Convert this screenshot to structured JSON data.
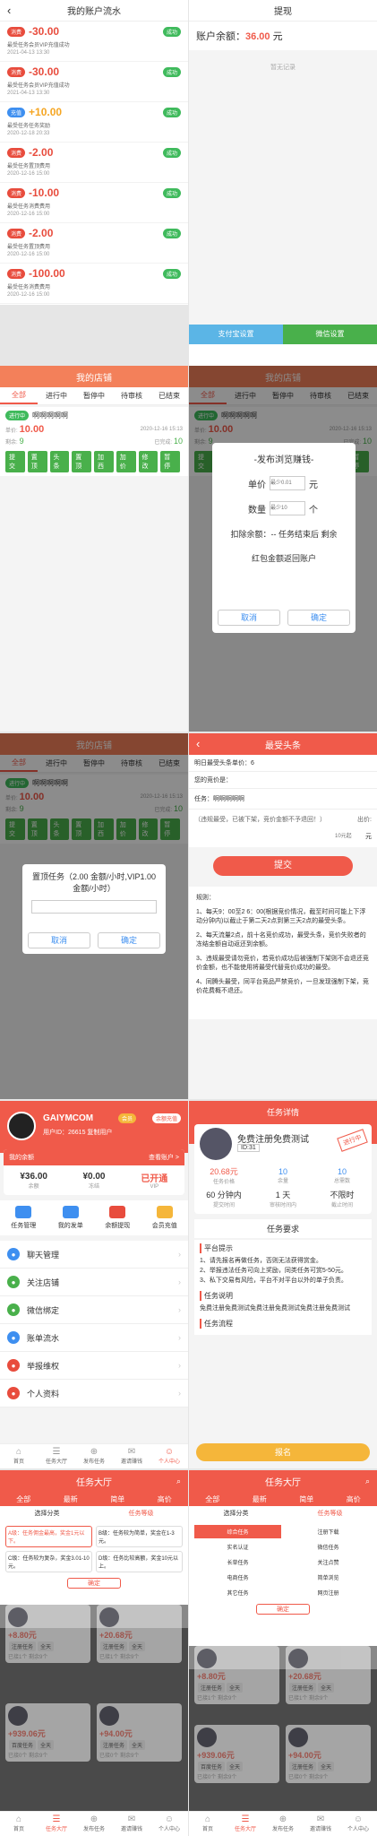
{
  "p1": {
    "title": "我的账户流水",
    "records": [
      {
        "badge": "消费",
        "amount": "-30.00",
        "desc": "最受任务会员VIP充值成功",
        "time": "2021-04-13 13:30",
        "type": "red"
      },
      {
        "badge": "消费",
        "amount": "-30.00",
        "desc": "最受任务会员VIP充值成功",
        "time": "2021-04-13 13:30",
        "type": "red"
      },
      {
        "badge": "充值",
        "amount": "+10.00",
        "desc": "最受任务任务奖励",
        "time": "2020-12-18 20:33",
        "type": "blue"
      },
      {
        "badge": "消费",
        "amount": "-2.00",
        "desc": "最受任务置顶费用",
        "time": "2020-12-16 15:00",
        "type": "red"
      },
      {
        "badge": "消费",
        "amount": "-10.00",
        "desc": "最受任务消费费用",
        "time": "2020-12-16 15:00",
        "type": "red"
      },
      {
        "badge": "消费",
        "amount": "-2.00",
        "desc": "最受任务置顶费用",
        "time": "2020-12-16 15:00",
        "type": "red"
      },
      {
        "badge": "消费",
        "amount": "-100.00",
        "desc": "最受任务消费费用",
        "time": "2020-12-16 15:00",
        "type": "red"
      }
    ],
    "status": "成功"
  },
  "p2": {
    "title": "提现",
    "balance_label": "账户余额：",
    "balance": "36.00",
    "unit": "元",
    "empty": "暂无记录",
    "btn_left": "支付宝设置",
    "btn_right": "微信设置"
  },
  "shop": {
    "title": "我的店铺",
    "tabs": [
      "全部",
      "进行中",
      "暂停中",
      "待审核",
      "已结束"
    ],
    "status": "进行中",
    "name": "啊啊啊啊啊",
    "price_label": "单价:",
    "price": "10.00",
    "time": "2020-12-16 15:13",
    "remain_label": "剩余:",
    "remain": "9",
    "done_label": "已完成:",
    "done": "10",
    "actions": [
      "提交",
      "置顶",
      "头条",
      "置顶",
      "加西",
      "加价",
      "修改",
      "暂停"
    ]
  },
  "modal1": {
    "title": "-发布浏览赚钱-",
    "price_label": "单价",
    "price_ph": "最少0.01",
    "price_unit": "元",
    "qty_label": "数量",
    "qty_ph": "最少10",
    "qty_unit": "个",
    "deduct": "扣除余额：-- 任务结束后 剩余",
    "refund": "红包金额返回账户",
    "cancel": "取消",
    "ok": "确定"
  },
  "modal2": {
    "title": "置顶任务（2.00 金额/小时,VIP1.00 金额/小时）",
    "cancel": "取消",
    "ok": "确定"
  },
  "headline": {
    "title": "最受头条",
    "l1": "明日最受头条单价：6",
    "l2": "您的竞价是：",
    "l3": "任务：啊啊啊啊啊",
    "l4": "（违规最受，已被下架，竞价金额不予退回！）",
    "l5": "出价:",
    "ph": "10元起",
    "unit": "元",
    "submit": "提交",
    "rules_title": "规则：",
    "rules": [
      "1、每天9：00至2 6：00(根据竞价情况，截至时间可能上下浮动分钟内)以截止于第二天2点到第三天2点的最受头条。",
      "2、每天流量2点，前十名竞价成功，最受头条，竞价失败者的冻结金额自动返还到余额。",
      "3、违规最受请勿竞价，若竞价成功后被强制下架则不会退还竞价金额，也不能使用将最受代替竞价成功的最受。",
      "4、同腾头最受，同平台竞品严禁竞价，一旦发现强制下架，竞价花费概不退还。"
    ]
  },
  "mine": {
    "name": "GAIYMCOM",
    "vip": "会员",
    "recharge": "余额充值",
    "uid": "用户ID：26615 复制用户",
    "mybal": "我的余额",
    "mybal_link": "查看账户 >",
    "stats": [
      {
        "v": "¥36.00",
        "l": "余额"
      },
      {
        "v": "¥0.00",
        "l": "冻结"
      },
      {
        "v": "已开通",
        "l": "VIP"
      }
    ],
    "grid": [
      "任务管理",
      "我的发单",
      "余额提现",
      "会员充值"
    ],
    "list": [
      "聊天管理",
      "关注店铺",
      "微信绑定",
      "账单流水",
      "举报维权",
      "个人资料"
    ],
    "tabbar": [
      "首页",
      "任务大厅",
      "发布任务",
      "邀请赚钱",
      "个人中心"
    ]
  },
  "detail": {
    "title": "任务详情",
    "task": "免费注册免费测试",
    "id": "ID:31",
    "stamp": "进行中",
    "stats": [
      {
        "v": "20.68元",
        "l": "任务价格"
      },
      {
        "v": "10",
        "l": "余量"
      },
      {
        "v": "10",
        "l": "总需数"
      }
    ],
    "stats2": [
      {
        "v": "60 分钟内",
        "l": "提交时间"
      },
      {
        "v": "1 天",
        "l": "审核时间内"
      },
      {
        "v": "不限时",
        "l": "截止时间"
      }
    ],
    "req": "任务要求",
    "tip_h": "平台提示",
    "tips": [
      "1、请先报名再做任务，否则无法获得赏金。",
      "2、举报违法任务可向上奖励，同类任务可赏5-50元。",
      "3、私下交易有风险，平台不对平台以外的单子负责。"
    ],
    "desc_h": "任务说明",
    "desc": "免费注册免费测试免费注册免费测试免费注册免费测试",
    "flow_h": "任务流程",
    "apply": "报名"
  },
  "hall": {
    "title": "任务大厅",
    "tabs": [
      "全部",
      "最新",
      "简单",
      "高价"
    ],
    "filter1": "选择分类",
    "filter2": "任务等级",
    "levels": [
      {
        "t": "A级：任务佣金最高，奖金1元以下。"
      },
      {
        "t": "B级：任务较为简单，奖金在1-3元。"
      },
      {
        "t": "C级：任务较为复杂，奖金3.01-10元。"
      },
      {
        "t": "D级：任务比较高额，奖金10元以上。"
      }
    ],
    "confirm": "确定",
    "cats": [
      "综合任务",
      "注册下载",
      "实名认证",
      "微信任务",
      "长草任务",
      "关注点赞",
      "电商任务",
      "简单浏览",
      "其它任务",
      "网页注册"
    ],
    "cards": [
      {
        "amt": "+8.80元",
        "tags": [
          "注册任务",
          "全天"
        ],
        "n": "已接1个 剩余9个"
      },
      {
        "amt": "+20.68元",
        "tags": [
          "注册任务",
          "全天"
        ],
        "n": "已接1个 剩余9个"
      },
      {
        "amt": "+939.06元",
        "tags": [
          "百度任务",
          "全天"
        ],
        "n": "已接0个 剩余9个"
      },
      {
        "amt": "+94.00元",
        "tags": [
          "注册任务",
          "全天"
        ],
        "n": "已接0个 剩余9个"
      }
    ],
    "tabbar": [
      "首页",
      "任务大厅",
      "发布任务",
      "邀请赚钱",
      "个人中心"
    ]
  },
  "colors": {
    "red": "#f05a4a",
    "green": "#49b04b",
    "orange": "#f3805a",
    "blue": "#3e8ff0"
  }
}
